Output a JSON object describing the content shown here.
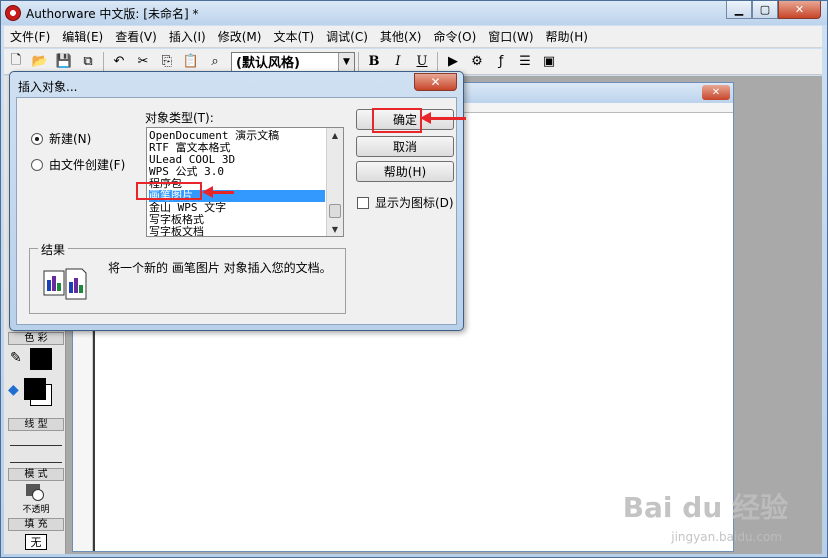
{
  "window": {
    "title": "Authorware 中文版: [未命名] *"
  },
  "menu": [
    "文件(F)",
    "编辑(E)",
    "查看(V)",
    "插入(I)",
    "修改(M)",
    "文本(T)",
    "调试(C)",
    "其他(X)",
    "命令(O)",
    "窗口(W)",
    "帮助(H)"
  ],
  "toolbar": {
    "style_combo": "(默认风格)",
    "bold": "B",
    "italic": "I",
    "underline": "U"
  },
  "tools_panel": {
    "color_label": "色 彩",
    "line_label": "线 型",
    "mode_label": "模 式",
    "mode_value": "不透明",
    "fill_label": "填 充",
    "fill_value": "无"
  },
  "dialog": {
    "title": "插入对象...",
    "radio_new": "新建(N)",
    "radio_file": "由文件创建(F)",
    "type_label": "对象类型(T):",
    "list_items": [
      "OpenDocument 演示文稿",
      "RTF 富文本格式",
      "ULead COOL 3D",
      "WPS 公式 3.0",
      "程序包",
      "画笔图片",
      "金山 WPS 文字",
      "写字板格式",
      "写字板文档"
    ],
    "selected_index": 5,
    "ok_button": "确定",
    "cancel_button": "取消",
    "help_button": "帮助(H)",
    "display_as_icon": "显示为图标(D)",
    "result_label": "结果",
    "result_text": "将一个新的 画笔图片 对象插入您的文档。"
  },
  "watermark": {
    "main": "Bai du 经验",
    "sub": "jingyan.baidu.com"
  },
  "colors": {
    "annotation": "#e8262a",
    "selection": "#3399ff"
  }
}
